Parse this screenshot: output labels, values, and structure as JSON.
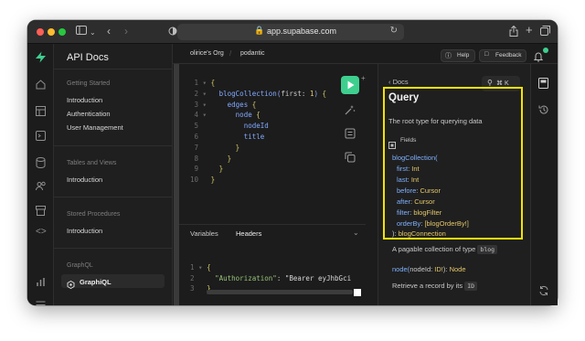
{
  "browser": {
    "url": "app.supabase.com"
  },
  "header": {
    "org": "olirice's Org",
    "project": "podantic",
    "help_label": "Help",
    "feedback_label": "Feedback"
  },
  "sidebar": {
    "title": "API Docs",
    "sections": [
      {
        "heading": "Getting Started",
        "items": [
          "Introduction",
          "Authentication",
          "User Management"
        ]
      },
      {
        "heading": "Tables and Views",
        "items": [
          "Introduction"
        ]
      },
      {
        "heading": "Stored Procedures",
        "items": [
          "Introduction"
        ]
      },
      {
        "heading": "GraphQL",
        "items": [
          "GraphiQL"
        ]
      }
    ]
  },
  "editor": {
    "lines": [
      {
        "n": "1",
        "fold": "▾",
        "text": "{"
      },
      {
        "n": "2",
        "fold": "▾",
        "text": "blogCollection(first: 1) {"
      },
      {
        "n": "3",
        "fold": "▾",
        "text": "edges {"
      },
      {
        "n": "4",
        "fold": "▾",
        "text": "node {"
      },
      {
        "n": "5",
        "fold": "",
        "text": "nodeId"
      },
      {
        "n": "6",
        "fold": "",
        "text": "title"
      },
      {
        "n": "7",
        "fold": "",
        "text": "}"
      },
      {
        "n": "8",
        "fold": "",
        "text": "}"
      },
      {
        "n": "9",
        "fold": "",
        "text": "}"
      },
      {
        "n": "10",
        "fold": "",
        "text": "}"
      }
    ],
    "variables_tab": "Variables",
    "headers_tab": "Headers",
    "header_lines": [
      {
        "n": "1",
        "fold": "▾",
        "text": "{"
      },
      {
        "n": "2",
        "key": "\"Authorization\"",
        "value": "\"Bearer eyJhbGci"
      },
      {
        "n": "3",
        "fold": "",
        "text": "}"
      }
    ]
  },
  "docs": {
    "back_label": "Docs",
    "shortcut": "⌘ K",
    "title": "Query",
    "description": "The root type for querying data",
    "fields_label": "Fields",
    "field_name": "blogCollection(",
    "args": [
      {
        "name": "first",
        "type": "Int"
      },
      {
        "name": "last",
        "type": "Int"
      },
      {
        "name": "before",
        "type": "Cursor"
      },
      {
        "name": "after",
        "type": "Cursor"
      },
      {
        "name": "filter",
        "type": "blogFilter"
      },
      {
        "name": "orderBy",
        "type": "[blogOrderBy!]"
      }
    ],
    "return_prefix": "):",
    "return_type": "blogConnection",
    "field_desc_prefix": "A pagable collection of type",
    "field_desc_badge": "blog",
    "node_field": "node(nodeId: ID!): Node",
    "node_desc_prefix": "Retrieve a record by its",
    "node_desc_badge": "ID"
  },
  "colors": {
    "accent": "#3ecf8e",
    "highlight": "#f2e200",
    "window_bg": "#1c1c1c"
  }
}
